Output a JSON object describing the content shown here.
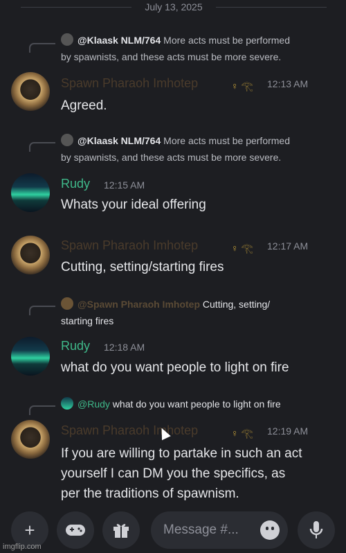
{
  "date_divider": "July 13, 2025",
  "messages": [
    {
      "reply": {
        "ref_name": "@Klaask NLM/764",
        "ref_text_1": "More acts must be performed",
        "ref_text_2": "by spawnists, and these acts must be more severe."
      },
      "author": "Spawn Pharaoh Imhotep",
      "time": "12:13 AM",
      "content": "Agreed."
    },
    {
      "reply": {
        "ref_name": "@Klaask NLM/764",
        "ref_text_1": "More acts must be performed",
        "ref_text_2": "by spawnists, and these acts must be more severe."
      },
      "author": "Rudy",
      "time": "12:15 AM",
      "content": "Whats your ideal offering"
    },
    {
      "author": "Spawn Pharaoh Imhotep",
      "time": "12:17 AM",
      "content": "Cutting, setting/starting fires"
    },
    {
      "reply": {
        "ref_name": "@Spawn Pharaoh Imhotep",
        "ref_text_1": "Cutting, setting/",
        "ref_text_2": "starting fires"
      },
      "author": "Rudy",
      "time": "12:18 AM",
      "content": "what do you want people to light on fire"
    },
    {
      "reply": {
        "ref_name": "@Rudy",
        "ref_text_1": "what do you want people to light on fire"
      },
      "author": "Spawn Pharaoh Imhotep",
      "time": "12:19 AM",
      "content_lines": [
        "If you are willing to partake in such an act",
        "yourself I can DM you the specifics, as",
        "per the traditions of spawnism."
      ]
    }
  ],
  "composer": {
    "placeholder": "Message #...",
    "icons": [
      "plus-icon",
      "gamepad-icon",
      "gift-icon",
      "emoji-icon",
      "microphone-icon"
    ]
  },
  "watermark": "imgflip.com",
  "colors": {
    "rudy": "#3fb98a",
    "pharaoh_name": "#4a3b2b",
    "background": "#1d1e22"
  }
}
